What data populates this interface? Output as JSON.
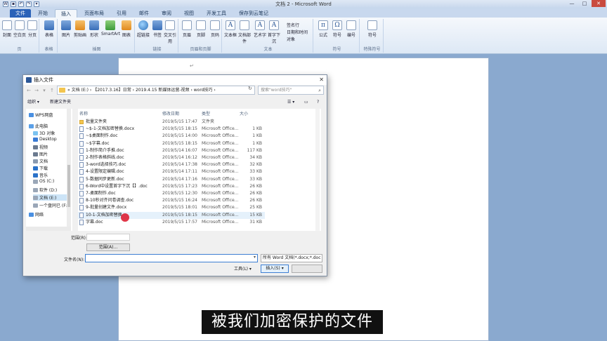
{
  "window": {
    "title": "文档 2 - Microsoft Word"
  },
  "tabs": [
    "文件",
    "开始",
    "插入",
    "页面布局",
    "引用",
    "邮件",
    "审阅",
    "视图",
    "开发工具",
    "保存到云笔记"
  ],
  "ribbon": {
    "groups": [
      {
        "name": "页",
        "buttons": [
          "封面",
          "空白页",
          "分页"
        ]
      },
      {
        "name": "表格",
        "buttons": [
          "表格"
        ]
      },
      {
        "name": "插图",
        "buttons": [
          "图片",
          "剪贴画",
          "形状",
          "SmartArt",
          "图表",
          "屏幕截图"
        ]
      },
      {
        "name": "链接",
        "buttons": [
          "超链接",
          "书签",
          "交叉引用"
        ]
      },
      {
        "name": "页眉和页脚",
        "buttons": [
          "页眉",
          "页脚",
          "页码"
        ]
      },
      {
        "name": "文本",
        "buttons": [
          "文本框",
          "文档部件",
          "艺术字",
          "首字下沉"
        ],
        "small": [
          "签名行",
          "日期和时间",
          "对象"
        ]
      },
      {
        "name": "符号",
        "buttons": [
          "公式",
          "符号",
          "编号"
        ]
      },
      {
        "name": "特殊符号",
        "buttons": [
          "符号"
        ]
      }
    ]
  },
  "dialog": {
    "title": "插入文件",
    "path": "« 文档 (E:) › 【2017.3.16】日常 › 2019.4.15 新媒体运营-视频 › word技巧 ›",
    "search_placeholder": "搜索\"word技巧\"",
    "toolbar": {
      "organize": "组织 ▾",
      "new_folder": "新建文件夹"
    },
    "sidebar": [
      "WPS网盘",
      "此电脑",
      "3D 对象",
      "Desktop",
      "视频",
      "图片",
      "文档",
      "下载",
      "音乐",
      "OS (C:)",
      "软件 (D:)",
      "文档 (E:)",
      "一个盘同已 (F:)",
      "网络"
    ],
    "columns": [
      "名称",
      "修改日期",
      "类型",
      "大小"
    ],
    "files": [
      {
        "name": "批量文件夹",
        "date": "2019/5/15 17:47",
        "type": "文件夹",
        "size": "",
        "folder": true
      },
      {
        "name": "~$-1-文档加密替换.docx",
        "date": "2019/5/15 18:15",
        "type": "Microsoft Office...",
        "size": "1 KB"
      },
      {
        "name": "~$桌面制作.doc",
        "date": "2019/5/15 14:00",
        "type": "Microsoft Office...",
        "size": "1 KB"
      },
      {
        "name": "~$字幕.doc",
        "date": "2019/5/15 18:15",
        "type": "Microsoft Office...",
        "size": "1 KB"
      },
      {
        "name": "1-制作简介手推.doc",
        "date": "2019/5/14 16:07",
        "type": "Microsoft Office...",
        "size": "117 KB"
      },
      {
        "name": "2-制作表格斜线.doc",
        "date": "2019/5/14 16:12",
        "type": "Microsoft Office...",
        "size": "34 KB"
      },
      {
        "name": "3-word选择技巧.doc",
        "date": "2019/5/14 17:38",
        "type": "Microsoft Office...",
        "size": "32 KB"
      },
      {
        "name": "4-设置限定编辑.doc",
        "date": "2019/5/14 17:11",
        "type": "Microsoft Office...",
        "size": "33 KB"
      },
      {
        "name": "5-数据同步更新.doc",
        "date": "2019/5/14 17:16",
        "type": "Microsoft Office...",
        "size": "33 KB"
      },
      {
        "name": "6-Word中设置首字下沉【】.doc",
        "date": "2019/5/15 17:23",
        "type": "Microsoft Office...",
        "size": "26 KB"
      },
      {
        "name": "7-桌面制作.doc",
        "date": "2019/5/15 12:30",
        "type": "Microsoft Office...",
        "size": "26 KB"
      },
      {
        "name": "8-10秒对齐问卷调查.doc",
        "date": "2019/5/15 16:24",
        "type": "Microsoft Office...",
        "size": "26 KB"
      },
      {
        "name": "9-批量创建文件.docx",
        "date": "2019/5/15 18:01",
        "type": "Microsoft Office...",
        "size": "25 KB"
      },
      {
        "name": "10-1-文档加密替换",
        "date": "2019/5/15 18:15",
        "type": "Microsoft Office...",
        "size": "15 KB"
      },
      {
        "name": "字幕.doc",
        "date": "2019/5/15 17:57",
        "type": "Microsoft Office...",
        "size": "31 KB"
      }
    ],
    "range_label": "范围(R):",
    "range_button": "范围(A)...",
    "filename_label": "文件名(N):",
    "filename_value": "",
    "filetype_value": "所有 Word 文档(*.docx;*.doc",
    "tools_label": "工具(L) ▾",
    "insert_label": "插入(S)",
    "cancel_label": "▾"
  },
  "subtitle": "被我们加密保护的文件"
}
